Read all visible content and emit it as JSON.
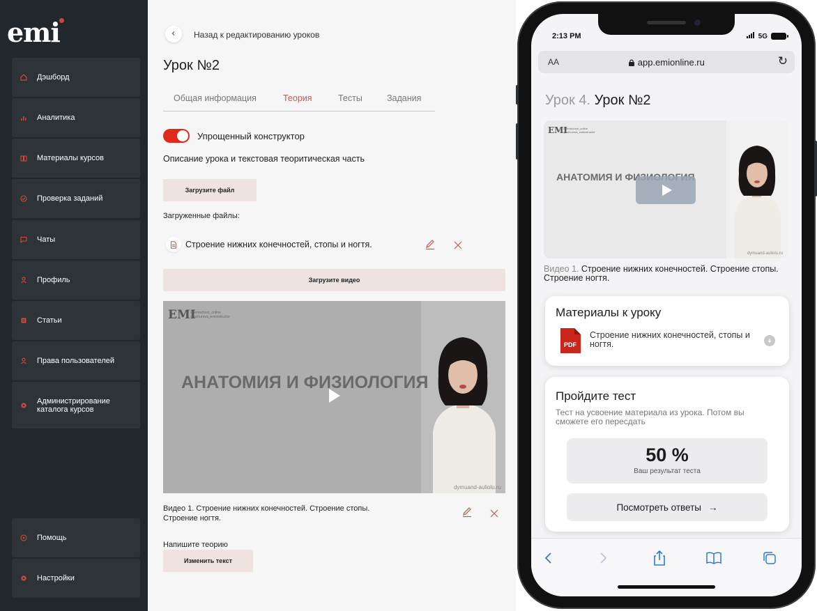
{
  "sidebar": {
    "logo": "emi",
    "items": [
      {
        "label": "Дэшборд",
        "icon": "home-icon"
      },
      {
        "label": "Аналитика",
        "icon": "bar-chart-icon"
      },
      {
        "label": "Материалы курсов",
        "icon": "book-icon"
      },
      {
        "label": "Проверка заданий",
        "icon": "check-circle-icon"
      },
      {
        "label": "Чаты",
        "icon": "chat-icon"
      },
      {
        "label": "Профиль",
        "icon": "user-icon"
      },
      {
        "label": "Статьи",
        "icon": "article-icon"
      },
      {
        "label": "Права пользователей",
        "icon": "user-rights-icon"
      },
      {
        "label": "Администрирование каталога курсов",
        "icon": "gear-icon"
      }
    ],
    "bottom_items": [
      {
        "label": "Помощь",
        "icon": "help-icon"
      },
      {
        "label": "Настройки",
        "icon": "settings-icon"
      }
    ],
    "accent_color": "#d34a45"
  },
  "editor": {
    "back_label": "Назад к редактированию уроков",
    "title": "Урок №2",
    "tabs": [
      {
        "label": "Общая информация",
        "active": false
      },
      {
        "label": "Теория",
        "active": true
      },
      {
        "label": "Тесты",
        "active": false
      },
      {
        "label": "Задания",
        "active": false
      }
    ],
    "toggle_label": "Упрощенный конструктор",
    "toggle_on": true,
    "description_label": "Описание урока и текстовая теоритическая часть",
    "upload_file_button": "Загрузите файл",
    "uploaded_files_label": "Загруженные файлы:",
    "file_name": "Строение нижних конечностей, стопы и ногтя.",
    "upload_video_button": "Загрузите видео",
    "video": {
      "logo": "EMI",
      "tag_line_1": "@emischool_online",
      "tag_line_2": "@ozhurova_emiinstructor",
      "title": "АНАТОМИЯ И ФИЗИОЛОГИЯ",
      "watermark": "dymuand-auliolu.ru"
    },
    "video_caption": "Видео 1. Строение нижних конечностей. Строение стопы. Строение ногтя.",
    "theory_label": "Напишите теорию",
    "edit_text_button": "Изменить текст",
    "accent_color": "#b95b55"
  },
  "phone": {
    "status_time": "2:13 PM",
    "network": "5G",
    "url_aa": "AA",
    "url": "app.emionline.ru",
    "lesson_prefix": "Урок 4.",
    "lesson_title": "Урок №2",
    "video": {
      "logo": "EMI",
      "tag_line_1": "@emischool_online",
      "tag_line_2": "@ozhurova_emiinstructor",
      "title": "АНАТОМИЯ И ФИЗИОЛОГИЯ",
      "watermark": "dymuand-auliolu.ru"
    },
    "caption_prefix": "Видео 1.",
    "caption_text": "Строение нижних конечностей. Строение стопы. Строение ногтя.",
    "materials": {
      "title": "Материалы к уроку",
      "pdf_label": "PDF",
      "file_name": "Строение нижних конечностей, стопы и ногтя."
    },
    "test": {
      "title": "Пройдите тест",
      "subtitle": "Тест на усвоение материала из урока. Потом вы сможете его пересдать",
      "score": "50 %",
      "score_label": "Ваш результат теста",
      "answers_button": "Посмотреть ответы",
      "answers_arrow": "→"
    }
  }
}
